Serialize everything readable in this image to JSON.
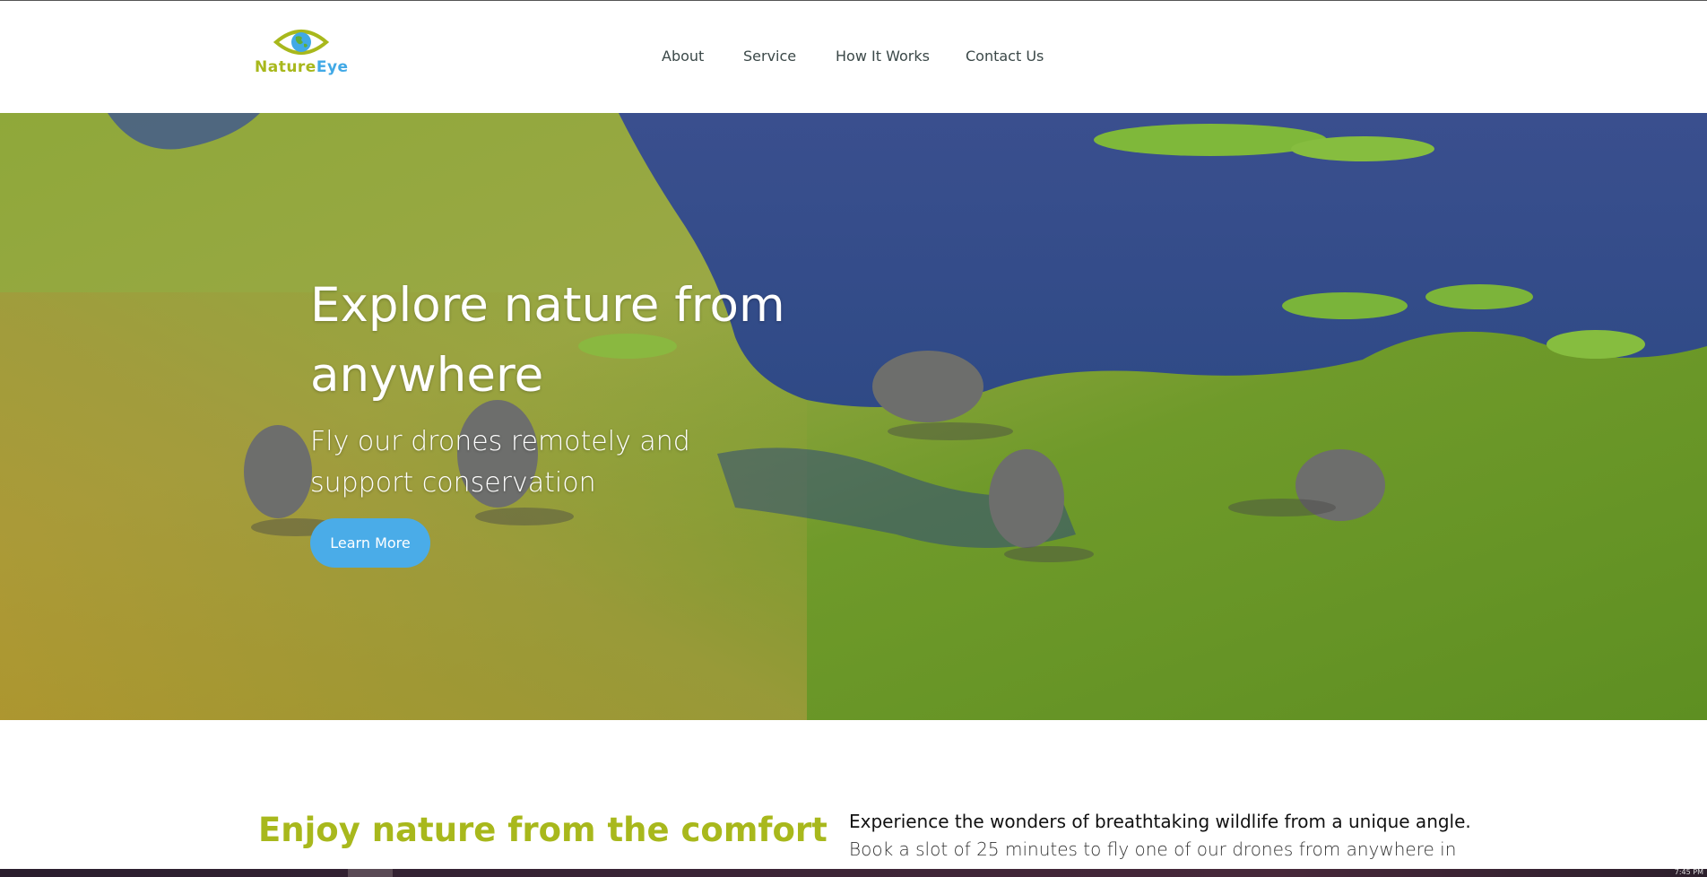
{
  "header": {
    "logo": {
      "text_part1": "Nature",
      "text_part2": "Eye",
      "icon": "eye-globe-icon",
      "color_primary": "#a8b81c",
      "color_secondary": "#41a9e6"
    },
    "nav": [
      {
        "label": "About"
      },
      {
        "label": "Service"
      },
      {
        "label": "How It Works"
      },
      {
        "label": "Contact Us"
      }
    ]
  },
  "hero": {
    "title": "Explore nature from anywhere",
    "subtitle": "Fly our drones remotely and support conservation",
    "button_label": "Learn More",
    "button_color": "#4aace8",
    "image": "aerial-elephants-wetland-photo"
  },
  "intro": {
    "heading": "Enjoy nature from the comfort",
    "heading_color": "#a8b81c",
    "lead": "Experience the wonders of breathtaking wildlife from a unique angle.",
    "body": "Book a slot of 25 minutes to fly one of our drones from anywhere in"
  },
  "taskbar": {
    "clock": "7:45 PM"
  }
}
